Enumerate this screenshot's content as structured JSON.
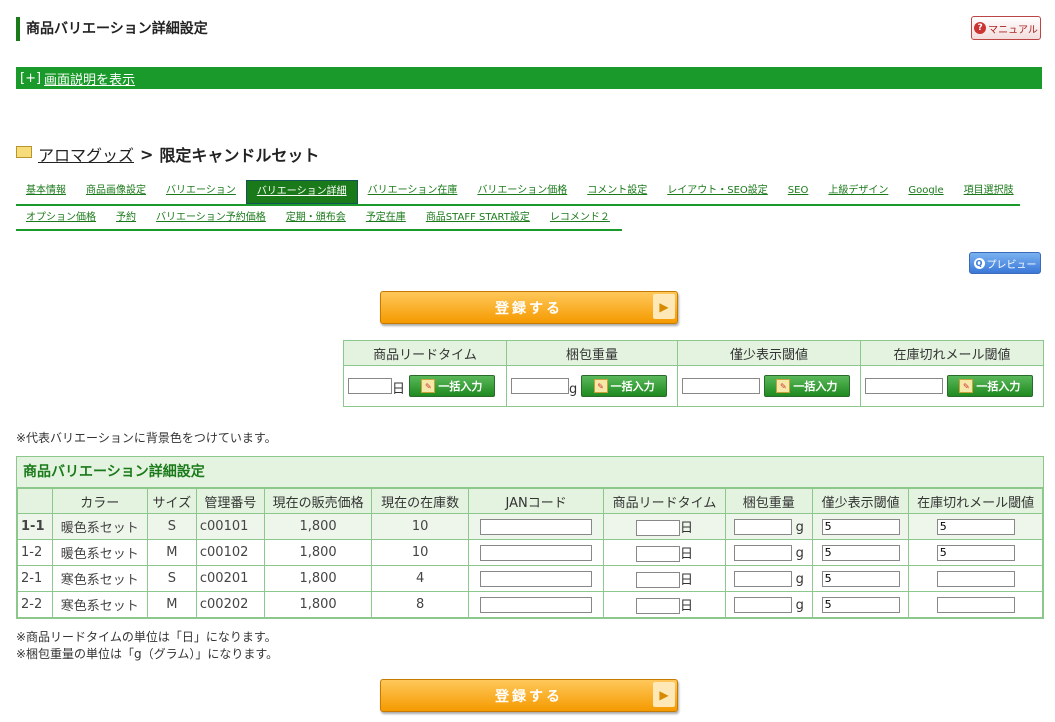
{
  "header": {
    "title": "商品バリエーション詳細設定",
    "manual_label": "マニュアル"
  },
  "help_bar": {
    "toggle": "[+]",
    "link": "画面説明を表示"
  },
  "breadcrumb": {
    "category": "アロマグッズ",
    "separator": ">",
    "product": "限定キャンドルセット"
  },
  "tabs_row1": [
    "基本情報",
    "商品画像設定",
    "バリエーション",
    "バリエーション詳細",
    "バリエーション在庫",
    "バリエーション価格",
    "コメント設定",
    "レイアウト・SEO設定",
    "SEO",
    "上級デザイン",
    "Google",
    "項目選択肢"
  ],
  "tabs_row2": [
    "オプション価格",
    "予約",
    "バリエーション予約価格",
    "定期・頒布会",
    "予定在庫",
    "商品STAFF START設定",
    "レコメンド２"
  ],
  "active_tab": "バリエーション詳細",
  "preview_label": "プレビュー",
  "submit_label": "登録する",
  "bulk": {
    "headers": [
      "商品リードタイム",
      "梱包重量",
      "僅少表示閾値",
      "在庫切れメール閾値"
    ],
    "lead_unit": "日",
    "weight_unit": "g",
    "button_label": "一括入力"
  },
  "note_top": "※代表バリエーションに背景色をつけています。",
  "detail": {
    "title": "商品バリエーション詳細設定",
    "columns": [
      "",
      "カラー",
      "サイズ",
      "管理番号",
      "現在の販売価格",
      "現在の在庫数",
      "JANコード",
      "商品リードタイム",
      "梱包重量",
      "僅少表示閾値",
      "在庫切れメール閾値"
    ],
    "lead_unit": "日",
    "weight_unit": "g",
    "rows": [
      {
        "no": "1-1",
        "color": "暖色系セット",
        "size": "S",
        "code": "c00101",
        "price": "1,800",
        "stock": "10",
        "low": "5",
        "out": "5",
        "rep": true
      },
      {
        "no": "1-2",
        "color": "暖色系セット",
        "size": "M",
        "code": "c00102",
        "price": "1,800",
        "stock": "10",
        "low": "5",
        "out": "5",
        "rep": false
      },
      {
        "no": "2-1",
        "color": "寒色系セット",
        "size": "S",
        "code": "c00201",
        "price": "1,800",
        "stock": "4",
        "low": "5",
        "out": "",
        "rep": false
      },
      {
        "no": "2-2",
        "color": "寒色系セット",
        "size": "M",
        "code": "c00202",
        "price": "1,800",
        "stock": "8",
        "low": "5",
        "out": "",
        "rep": false
      }
    ]
  },
  "notes_bottom": [
    "※商品リードタイムの単位は「日」になります。",
    "※梱包重量の単位は「g（グラム）」になります。"
  ],
  "colors": {
    "brand_green": "#1a9a2a",
    "table_border": "#8cc88c",
    "header_bg": "#e4f3e0",
    "button_orange": "#f59a00"
  }
}
